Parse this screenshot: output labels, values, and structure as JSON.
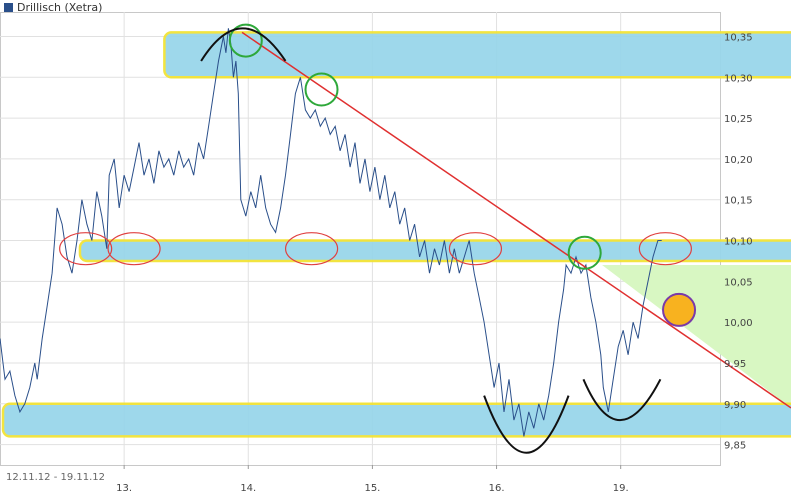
{
  "chart_data": {
    "type": "line",
    "title": "Drillisch (Xetra)",
    "series": [
      {
        "name": "Drillisch (Xetra)",
        "color": "#2a4f8a",
        "points": [
          [
            0.0,
            9.98
          ],
          [
            0.04,
            9.93
          ],
          [
            0.08,
            9.94
          ],
          [
            0.12,
            9.91
          ],
          [
            0.16,
            9.89
          ],
          [
            0.2,
            9.9
          ],
          [
            0.24,
            9.92
          ],
          [
            0.28,
            9.95
          ],
          [
            0.3,
            9.93
          ],
          [
            0.34,
            9.98
          ],
          [
            0.38,
            10.02
          ],
          [
            0.42,
            10.06
          ],
          [
            0.46,
            10.14
          ],
          [
            0.5,
            10.12
          ],
          [
            0.54,
            10.08
          ],
          [
            0.58,
            10.06
          ],
          [
            0.62,
            10.1
          ],
          [
            0.66,
            10.15
          ],
          [
            0.7,
            10.12
          ],
          [
            0.74,
            10.1
          ],
          [
            0.78,
            10.16
          ],
          [
            0.82,
            10.13
          ],
          [
            0.86,
            10.09
          ],
          [
            0.88,
            10.18
          ],
          [
            0.92,
            10.2
          ],
          [
            0.96,
            10.14
          ],
          [
            1.0,
            10.18
          ],
          [
            1.04,
            10.16
          ],
          [
            1.08,
            10.19
          ],
          [
            1.12,
            10.22
          ],
          [
            1.16,
            10.18
          ],
          [
            1.2,
            10.2
          ],
          [
            1.24,
            10.17
          ],
          [
            1.28,
            10.21
          ],
          [
            1.32,
            10.19
          ],
          [
            1.36,
            10.2
          ],
          [
            1.4,
            10.18
          ],
          [
            1.44,
            10.21
          ],
          [
            1.48,
            10.19
          ],
          [
            1.52,
            10.2
          ],
          [
            1.56,
            10.18
          ],
          [
            1.6,
            10.22
          ],
          [
            1.64,
            10.2
          ],
          [
            1.68,
            10.24
          ],
          [
            1.72,
            10.28
          ],
          [
            1.76,
            10.32
          ],
          [
            1.8,
            10.35
          ],
          [
            1.82,
            10.33
          ],
          [
            1.84,
            10.36
          ],
          [
            1.86,
            10.34
          ],
          [
            1.88,
            10.3
          ],
          [
            1.9,
            10.32
          ],
          [
            1.92,
            10.28
          ],
          [
            1.94,
            10.15
          ],
          [
            1.98,
            10.13
          ],
          [
            2.02,
            10.16
          ],
          [
            2.06,
            10.14
          ],
          [
            2.1,
            10.18
          ],
          [
            2.14,
            10.14
          ],
          [
            2.18,
            10.12
          ],
          [
            2.22,
            10.11
          ],
          [
            2.26,
            10.14
          ],
          [
            2.3,
            10.18
          ],
          [
            2.34,
            10.23
          ],
          [
            2.38,
            10.28
          ],
          [
            2.42,
            10.3
          ],
          [
            2.46,
            10.26
          ],
          [
            2.5,
            10.25
          ],
          [
            2.54,
            10.26
          ],
          [
            2.58,
            10.24
          ],
          [
            2.62,
            10.25
          ],
          [
            2.66,
            10.23
          ],
          [
            2.7,
            10.24
          ],
          [
            2.74,
            10.21
          ],
          [
            2.78,
            10.23
          ],
          [
            2.82,
            10.19
          ],
          [
            2.86,
            10.22
          ],
          [
            2.9,
            10.17
          ],
          [
            2.94,
            10.2
          ],
          [
            2.98,
            10.16
          ],
          [
            3.02,
            10.19
          ],
          [
            3.06,
            10.15
          ],
          [
            3.1,
            10.18
          ],
          [
            3.14,
            10.14
          ],
          [
            3.18,
            10.16
          ],
          [
            3.22,
            10.12
          ],
          [
            3.26,
            10.14
          ],
          [
            3.3,
            10.1
          ],
          [
            3.34,
            10.12
          ],
          [
            3.38,
            10.08
          ],
          [
            3.42,
            10.1
          ],
          [
            3.46,
            10.06
          ],
          [
            3.5,
            10.09
          ],
          [
            3.54,
            10.07
          ],
          [
            3.58,
            10.1
          ],
          [
            3.62,
            10.06
          ],
          [
            3.66,
            10.09
          ],
          [
            3.7,
            10.06
          ],
          [
            3.74,
            10.08
          ],
          [
            3.78,
            10.1
          ],
          [
            3.82,
            10.06
          ],
          [
            3.86,
            10.03
          ],
          [
            3.9,
            10.0
          ],
          [
            3.94,
            9.96
          ],
          [
            3.98,
            9.92
          ],
          [
            4.02,
            9.95
          ],
          [
            4.06,
            9.89
          ],
          [
            4.1,
            9.93
          ],
          [
            4.14,
            9.88
          ],
          [
            4.18,
            9.9
          ],
          [
            4.22,
            9.86
          ],
          [
            4.26,
            9.89
          ],
          [
            4.3,
            9.87
          ],
          [
            4.34,
            9.9
          ],
          [
            4.38,
            9.88
          ],
          [
            4.42,
            9.91
          ],
          [
            4.46,
            9.95
          ],
          [
            4.5,
            10.0
          ],
          [
            4.54,
            10.04
          ],
          [
            4.56,
            10.07
          ],
          [
            4.6,
            10.06
          ],
          [
            4.64,
            10.08
          ],
          [
            4.68,
            10.06
          ],
          [
            4.72,
            10.07
          ],
          [
            4.76,
            10.03
          ],
          [
            4.8,
            10.0
          ],
          [
            4.84,
            9.96
          ],
          [
            4.86,
            9.92
          ],
          [
            4.9,
            9.89
          ],
          [
            4.94,
            9.93
          ],
          [
            4.98,
            9.97
          ],
          [
            5.02,
            9.99
          ],
          [
            5.06,
            9.96
          ],
          [
            5.1,
            10.0
          ],
          [
            5.14,
            9.98
          ],
          [
            5.18,
            10.02
          ],
          [
            5.22,
            10.05
          ],
          [
            5.26,
            10.08
          ],
          [
            5.3,
            10.1
          ],
          [
            5.33,
            10.1
          ]
        ]
      }
    ],
    "x_ticks": [
      {
        "x": 1,
        "label": "13."
      },
      {
        "x": 2,
        "label": "14."
      },
      {
        "x": 3,
        "label": "15."
      },
      {
        "x": 4,
        "label": "16."
      },
      {
        "x": 5,
        "label": "19."
      }
    ],
    "y_ticks": [
      9.85,
      9.9,
      9.95,
      10.0,
      10.05,
      10.1,
      10.15,
      10.2,
      10.25,
      10.3,
      10.35
    ],
    "y_tick_labels": [
      "9,85",
      "9,90",
      "9,95",
      "10,00",
      "10,05",
      "10,10",
      "10,15",
      "10,20",
      "10,25",
      "10,30",
      "10,35"
    ],
    "xlim": [
      0,
      5.8
    ],
    "ylim": [
      9.825,
      10.38
    ],
    "date_range": "12.11.12 - 19.11.12",
    "grid": true,
    "legend": "top-left",
    "annotations": {
      "bands": [
        {
          "name": "resistance-band-top",
          "x": [
            1.3,
            5.8
          ],
          "y": [
            10.3,
            10.355
          ]
        },
        {
          "name": "support-band-middle",
          "x": [
            0.62,
            5.8
          ],
          "y": [
            10.075,
            10.1
          ]
        },
        {
          "name": "support-band-bottom",
          "x": [
            0.0,
            5.8
          ],
          "y": [
            9.86,
            9.9
          ]
        }
      ],
      "trendline": {
        "from": [
          1.95,
          10.355
        ],
        "to": [
          5.8,
          9.895
        ],
        "color": "#e03030"
      },
      "green_circles": [
        [
          1.98,
          10.345
        ],
        [
          2.59,
          10.285
        ],
        [
          4.71,
          10.085
        ]
      ],
      "red_ellipses": [
        [
          0.69,
          10.09
        ],
        [
          1.08,
          10.09
        ],
        [
          2.51,
          10.09
        ],
        [
          3.83,
          10.09
        ],
        [
          5.36,
          10.09
        ]
      ],
      "arcs_top": [
        [
          1.62,
          10.32,
          2.3,
          10.32,
          1.95,
          10.36
        ]
      ],
      "arcs_bottom": [
        [
          3.9,
          9.91,
          4.58,
          9.91,
          4.24,
          9.84
        ],
        [
          4.7,
          9.93,
          5.32,
          9.93,
          4.98,
          9.88
        ]
      ],
      "highlight_point": [
        5.47,
        10.015
      ],
      "triangle": [
        [
          4.85,
          10.07
        ],
        [
          5.8,
          10.07
        ],
        [
          5.8,
          9.895
        ]
      ]
    }
  }
}
